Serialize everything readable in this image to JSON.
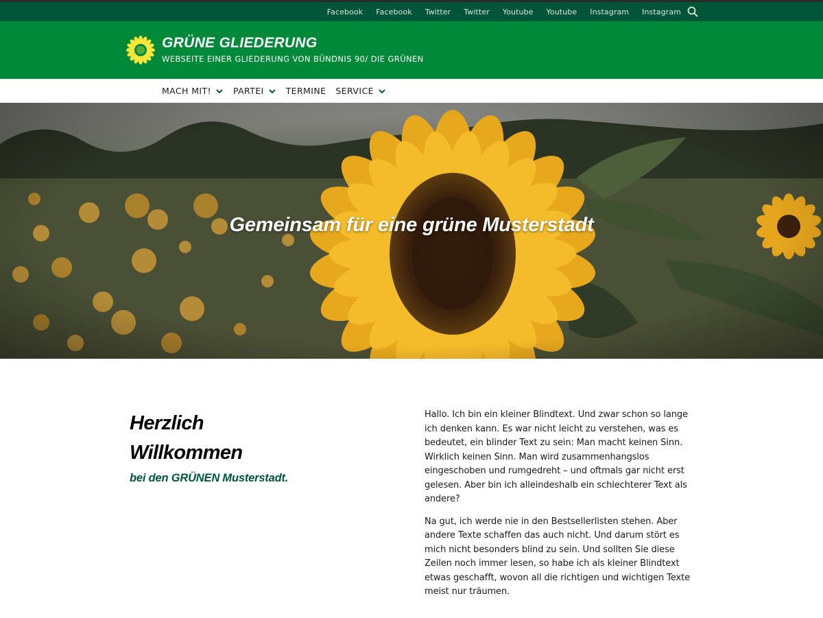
{
  "social_links": [
    {
      "label": "Facebook",
      "name": "facebook"
    },
    {
      "label": "Facebook",
      "name": "facebook"
    },
    {
      "label": "Twitter",
      "name": "twitter"
    },
    {
      "label": "Twitter",
      "name": "twitter"
    },
    {
      "label": "Youtube",
      "name": "youtube"
    },
    {
      "label": "Youtube",
      "name": "youtube"
    },
    {
      "label": "Instagram",
      "name": "instagram"
    },
    {
      "label": "Instagram",
      "name": "instagram"
    }
  ],
  "header": {
    "title": "GRÜNE GLIEDERUNG",
    "subtitle": "WEBSEITE EINER GLIEDERUNG VON BÜNDNIS 90/ DIE GRÜNEN",
    "logo_icon": "sunflower-icon"
  },
  "nav": {
    "items": [
      {
        "label": "MACH MIT!",
        "has_dropdown": true
      },
      {
        "label": "PARTEI",
        "has_dropdown": true
      },
      {
        "label": "TERMINE",
        "has_dropdown": false
      },
      {
        "label": "SERVICE",
        "has_dropdown": true
      }
    ]
  },
  "hero": {
    "title": "Gemeinsam für eine grüne Musterstadt"
  },
  "welcome": {
    "line1": "Herzlich",
    "line2": "Willkommen",
    "subtitle": "bei den GRÜNEN Musterstadt."
  },
  "body": {
    "paragraphs": [
      "Hallo. Ich bin ein kleiner Blindtext. Und zwar schon so lange ich denken kann. Es war nicht leicht zu verstehen, was es bedeutet, ein blinder Text zu sein: Man macht keinen Sinn. Wirklich keinen Sinn. Man wird zusammenhangslos eingeschoben und rumgedreht – und oftmals gar nicht erst gelesen. Aber bin ich alleindeshalb ein schlechterer Text als andere?",
      "Na gut, ich werde nie in den Bestsellerlisten stehen. Aber andere Texte schaffen das auch nicht. Und darum stört es mich nicht besonders blind zu sein. Und sollten Sie diese Zeilen noch immer lesen, so habe ich als kleiner Blindtext etwas geschafft, wovon all die richtigen und wichtigen Texte meist nur träumen."
    ]
  },
  "colors": {
    "topbar": "#005437",
    "header": "#008939",
    "accent_dark": "#005437",
    "sunflower": "#f5c518"
  }
}
